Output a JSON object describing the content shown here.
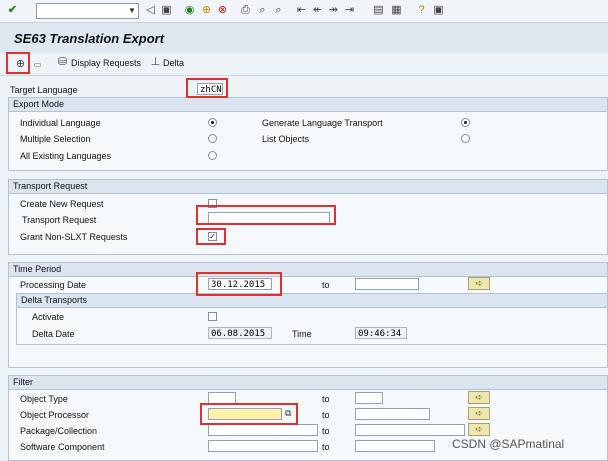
{
  "window": {
    "title": "SE63 Translation Export"
  },
  "app_toolbar": {
    "display_requests": "Display Requests",
    "delta": "Delta"
  },
  "target_language": {
    "label": "Target Language",
    "value": "zhCN"
  },
  "export_mode": {
    "title": "Export Mode",
    "individual": "Individual Language",
    "multiple": "Multiple Selection",
    "all_existing": "All Existing Languages",
    "generate_transport": "Generate Language Transport",
    "list_objects": "List Objects"
  },
  "transport_request": {
    "title": "Transport Request",
    "create_new": "Create New Request",
    "request_label": "Transport Request",
    "request_value": "",
    "grant_nonslxt": "Grant Non-SLXT Requests"
  },
  "time_period": {
    "title": "Time Period",
    "processing_date_label": "Processing Date",
    "processing_date_value": "30.12.2015",
    "to_label": "to",
    "delta_title": "Delta Transports",
    "activate": "Activate",
    "delta_date_label": "Delta Date",
    "delta_date_value": "06.08.2015",
    "time_label": "Time",
    "time_value": "09:46:34"
  },
  "filter": {
    "title": "Filter",
    "object_type": "Object Type",
    "object_processor": "Object Processor",
    "package": "Package/Collection",
    "software_component": "Software Component",
    "to_label": "to"
  },
  "watermark": "CSDN @SAPmatinal",
  "icons": [
    "check-icon",
    "save-icon",
    "back-icon",
    "exit-icon",
    "cancel-icon",
    "print-icon",
    "find-icon",
    "find-next-icon",
    "first-page-icon",
    "prev-page-icon",
    "next-page-icon",
    "last-page-icon",
    "new-session-icon",
    "shortcut-icon",
    "help-icon",
    "customize-icon",
    "execute-icon",
    "background-job-icon",
    "display-requests-icon",
    "delta-icon",
    "arrow-right-icon",
    "multiple-selection-icon"
  ],
  "colors": {
    "highlight": "#e03030",
    "title_bar": "#dfe8f1",
    "background": "#eef3f8",
    "arrow_button": "#f0e6b0"
  }
}
